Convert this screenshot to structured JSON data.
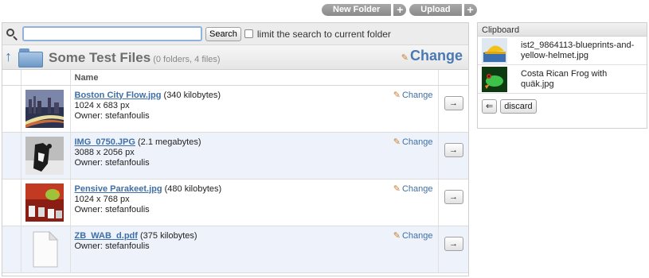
{
  "toolbar": {
    "new_folder": "New Folder",
    "upload": "Upload",
    "plus": "+"
  },
  "search": {
    "value": "",
    "placeholder": "",
    "button": "Search",
    "limit_label": "limit the search to current folder"
  },
  "folder": {
    "title": "Some Test Files",
    "info": "(0 folders, 4 files)",
    "change": "Change",
    "up_arrow": "↑"
  },
  "table": {
    "name_header": "Name",
    "change_label": "Change",
    "go_label": "→",
    "rows": [
      {
        "name": "Boston City Flow.jpg",
        "size": "(340 kilobytes)",
        "dims": "1024 x 683 px",
        "owner": "Owner: stefanfoulis"
      },
      {
        "name": "IMG_0750.JPG",
        "size": "(2.1 megabytes)",
        "dims": "3088 x 2056 px",
        "owner": "Owner: stefanfoulis"
      },
      {
        "name": "Pensive Parakeet.jpg",
        "size": "(480 kilobytes)",
        "dims": "1024 x 768 px",
        "owner": "Owner: stefanfoulis"
      },
      {
        "name": "ZB_WAB_d.pdf",
        "size": "(375 kilobytes)",
        "dims": "",
        "owner": "Owner: stefanfoulis"
      }
    ]
  },
  "clipboard": {
    "title": "Clipboard",
    "items": [
      {
        "name": "ist2_9864113-blueprints-and-yellow-helmet.jpg"
      },
      {
        "name": "Costa Rican Frog with quäk.jpg"
      }
    ],
    "back": "⇐",
    "discard": "discard"
  },
  "colors": {
    "link": "#3f6fa6",
    "accent": "#4a78b2",
    "alt_row": "#eef3fb"
  }
}
